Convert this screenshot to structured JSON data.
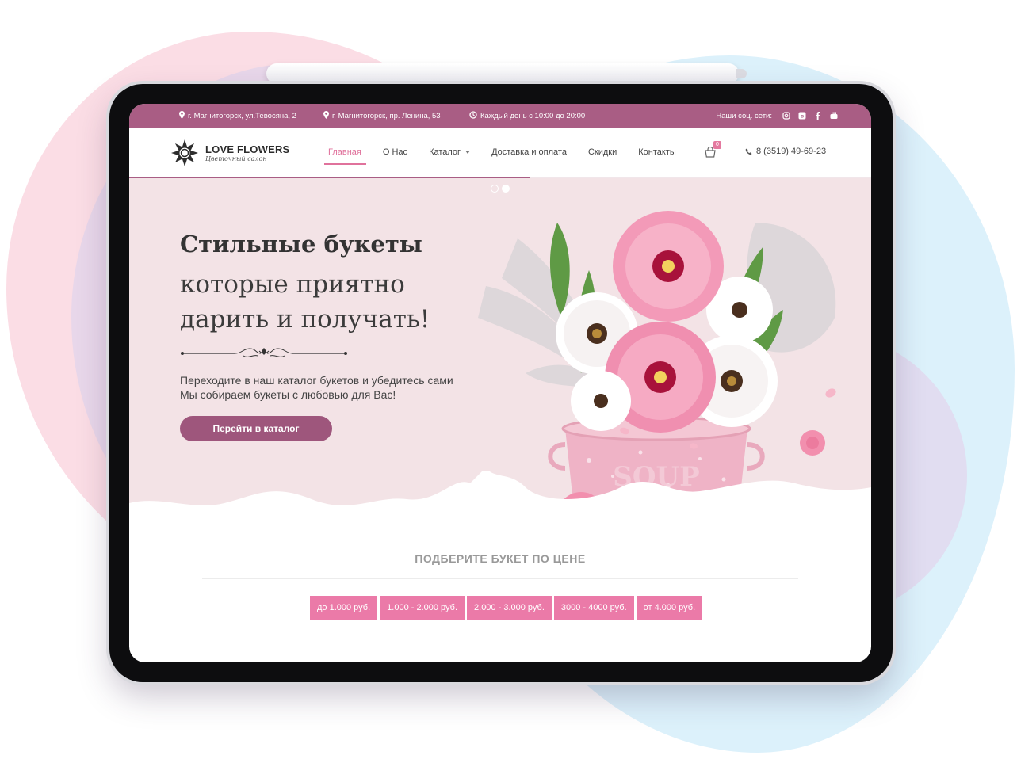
{
  "topbar": {
    "address1": "г. Магнитогорск, ул.Тевосяна, 2",
    "address2": "г. Магнитогорск, пр. Ленина, 53",
    "hours": "Каждый день с 10:00 до 20:00",
    "social_label": "Наши соц. сети:",
    "social": [
      "instagram-icon",
      "vk-icon",
      "facebook-icon",
      "youtube-icon"
    ]
  },
  "logo": {
    "title": "LOVE FLOWERS",
    "subtitle": "Цветочный салон"
  },
  "nav": {
    "items": [
      "Главная",
      "О Нас",
      "Каталог",
      "Доставка и оплата",
      "Скидки",
      "Контакты"
    ],
    "active": "Главная"
  },
  "cart": {
    "count": "0"
  },
  "phone": "8 (3519) 49-69-23",
  "hero": {
    "title1": "Стильные букеты",
    "title2": "которые приятно",
    "title3": "дарить и получать!",
    "text1": "Переходите в наш каталог букетов и убедитесь сами",
    "text2": "Мы собираем букеты с любовью для Вас!",
    "cta": "Перейти в каталог",
    "pot_label": "SOUP"
  },
  "prices": {
    "title": "ПОДБЕРИТЕ БУКЕТ ПО ЦЕНЕ",
    "buttons": [
      "до 1.000 руб.",
      "1.000 - 2.000 руб.",
      "2.000 - 3.000 руб.",
      "3000 - 4000 руб.",
      "от 4.000 руб."
    ]
  },
  "colors": {
    "accent": "#a95d84",
    "pink": "#eb7aa8",
    "hero_bg": "#f3e3e6"
  }
}
